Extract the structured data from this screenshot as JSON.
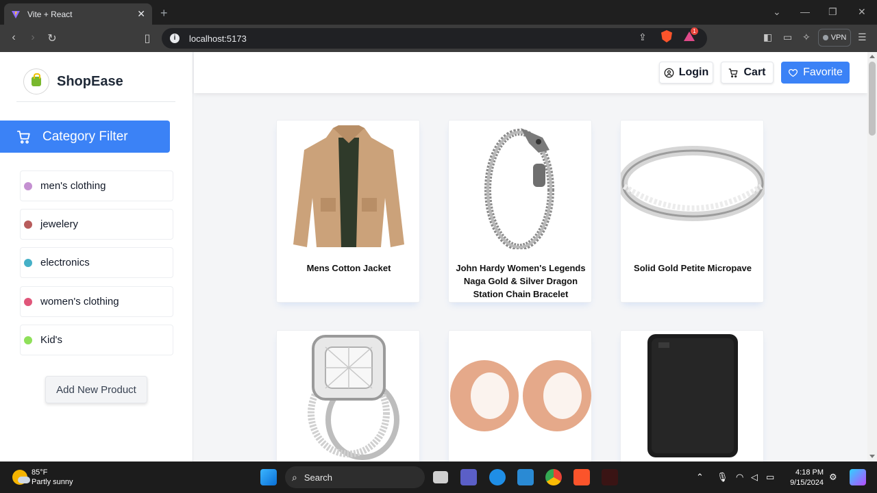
{
  "browser": {
    "tab_title": "Vite + React",
    "tab_close": "✕",
    "new_tab": "+",
    "url": "localhost:5173",
    "info_icon": "i",
    "brave_badge": "1",
    "vpn_label": "VPN",
    "window_controls": {
      "minimize": "—",
      "restore": "❐",
      "close": "✕"
    }
  },
  "sidebar": {
    "brand": "ShopEase",
    "category_filter_label": "Category Filter",
    "categories": [
      {
        "label": "men's clothing",
        "color": "#c490d1"
      },
      {
        "label": "jewelery",
        "color": "#b85c5c"
      },
      {
        "label": "electronics",
        "color": "#45b0c7"
      },
      {
        "label": "women's clothing",
        "color": "#e0567a"
      },
      {
        "label": "Kid's",
        "color": "#8fe05a"
      }
    ],
    "add_product_label": "Add New Product"
  },
  "header": {
    "login_label": "Login",
    "cart_label": "Cart",
    "favorite_label": "Favorite",
    "accent": "#3b82f6"
  },
  "products": [
    {
      "title": "Mens Cotton Jacket",
      "icon": "jacket"
    },
    {
      "title": "John Hardy Women's Legends Naga Gold & Silver Dragon Station Chain Bracelet",
      "icon": "bracelet"
    },
    {
      "title": "Solid Gold Petite Micropave",
      "icon": "ring"
    },
    {
      "title": "",
      "icon": "diamond-ring"
    },
    {
      "title": "",
      "icon": "rose-gold-plugs"
    },
    {
      "title": "",
      "icon": "external-hard-drive"
    }
  ],
  "taskbar": {
    "temperature": "85°F",
    "weather": "Partly sunny",
    "search_label": "Search",
    "time": "4:18 PM",
    "date": "9/15/2024"
  }
}
